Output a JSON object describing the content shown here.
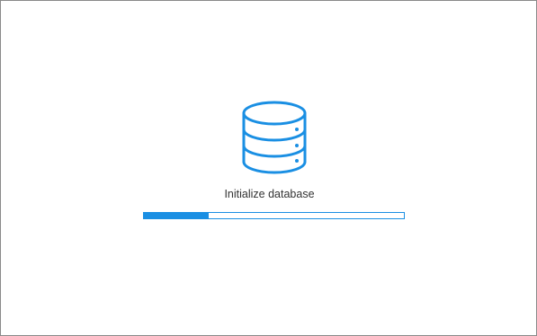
{
  "status": {
    "message": "Initialize database"
  },
  "progress": {
    "percent": 25
  },
  "icon": {
    "name": "database-icon",
    "color": "#1a8fe3"
  },
  "theme": {
    "accent": "#1a8fe3",
    "background": "#ffffff"
  }
}
